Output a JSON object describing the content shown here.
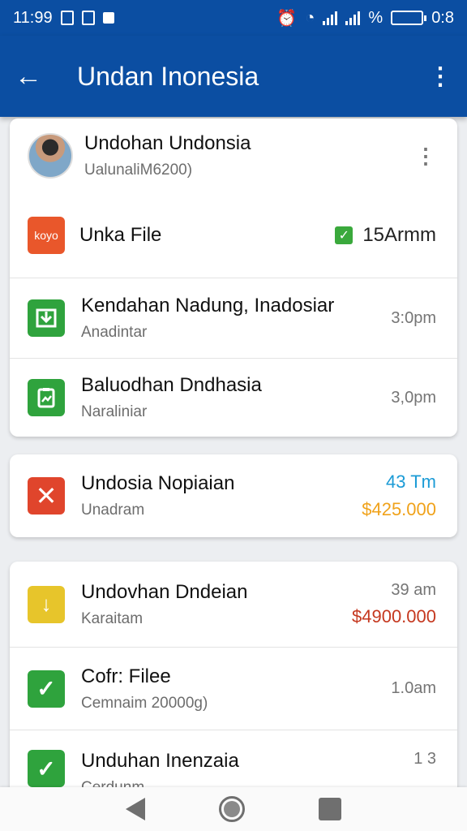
{
  "status_bar": {
    "time": "11:99",
    "pct": "%",
    "clock": "0:8"
  },
  "app_bar": {
    "back_icon": "arrow-left-icon",
    "title": "Undan Inonesia",
    "menu_icon": "more-vert-icon"
  },
  "colors": {
    "primary": "#0b4ea2",
    "green": "#2fa33d",
    "red": "#e0452c",
    "orange": "#e9572b",
    "yellow": "#e7c52b",
    "blue_time": "#1b9bd6",
    "price_orange": "#f0a21a",
    "price_red": "#c5381f"
  },
  "card1": {
    "profile": {
      "name": "Undohan Undonsia",
      "subtitle": "UalunaliM6200)"
    },
    "file_row": {
      "icon_text": "koyo",
      "title": "Unka File",
      "storage": "15Armm"
    },
    "items": [
      {
        "icon": "download-tray-icon",
        "title": "Kendahan Nadung, Inadosiar",
        "subtitle": "Anadintar",
        "time": "3:0pm"
      },
      {
        "icon": "clipboard-chart-icon",
        "title": "Baluodhan Dndhasia",
        "subtitle": "Naraliniar",
        "time": "3,0pm"
      }
    ]
  },
  "card2": {
    "title": "Undosia Nopiaian",
    "subtitle": "Unadram",
    "time": "43 Tm",
    "price": "$425.000"
  },
  "card3": {
    "items": [
      {
        "icon": "arrow-down-icon",
        "title": "Undovhan Dndeian",
        "subtitle": "Karaitam",
        "time": "39 am",
        "price": "$4900.000"
      },
      {
        "icon": "check-icon",
        "title": "Cofr: Filee",
        "subtitle": "Cemnaim 20000g)",
        "time": "1.0am"
      },
      {
        "icon": "check-icon",
        "title": "Unduhan Inenzaia",
        "subtitle": "Cerdunm",
        "time": "1 3"
      }
    ]
  },
  "nav_bar": {
    "back": "nav-back-icon",
    "home": "nav-home-icon",
    "recent": "nav-recent-icon"
  }
}
